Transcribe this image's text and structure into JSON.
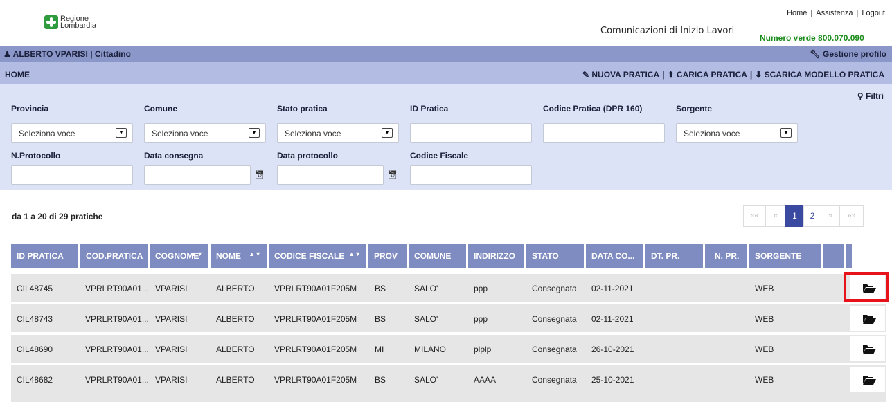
{
  "header": {
    "logo_line1": "Regione",
    "logo_line2": "Lombardia",
    "links": [
      "Home",
      "Assistenza",
      "Logout"
    ],
    "app_title": "Comunicazioni di Inizio Lavori",
    "phone": "Numero verde 800.070.090"
  },
  "userbar": {
    "user": "ALBERTO VPARISI | Cittadino",
    "profile": "Gestione profilo"
  },
  "navbar": {
    "home": "HOME",
    "actions": [
      "NUOVA PRATICA",
      "CARICA PRATICA",
      "SCARICA MODELLO PRATICA"
    ]
  },
  "filters": {
    "toggle": "Filtri",
    "provincia": {
      "label": "Provincia",
      "value": "Seleziona voce"
    },
    "comune": {
      "label": "Comune",
      "value": "Seleziona voce"
    },
    "stato": {
      "label": "Stato pratica",
      "value": "Seleziona voce"
    },
    "id_pratica": {
      "label": "ID Pratica",
      "value": ""
    },
    "codice_pratica": {
      "label": "Codice Pratica (DPR 160)",
      "value": ""
    },
    "sorgente": {
      "label": "Sorgente",
      "value": "Seleziona voce"
    },
    "protocollo": {
      "label": "N.Protocollo",
      "value": ""
    },
    "data_consegna": {
      "label": "Data consegna",
      "value": ""
    },
    "data_protocollo": {
      "label": "Data protocollo",
      "value": ""
    },
    "codice_fiscale": {
      "label": "Codice Fiscale",
      "value": ""
    }
  },
  "results": {
    "count": "da 1 a 20 di 29 pratiche"
  },
  "pagination": {
    "first": "««",
    "prev": "«",
    "pages": [
      "1",
      "2"
    ],
    "current": "1",
    "next": "»",
    "last": "»»"
  },
  "table": {
    "columns": [
      "ID PRATICA",
      "COD.PRATICA",
      "COGNOME",
      "NOME",
      "CODICE FISCALE",
      "PROV",
      "COMUNE",
      "INDIRIZZO",
      "STATO",
      "DATA CO...",
      "DT. PR.",
      "N. PR.",
      "SORGENTE",
      "",
      ""
    ],
    "rows": [
      {
        "id": "CIL48745",
        "cod": "VPRLRT90A01...",
        "cognome": "VPARISI",
        "nome": "ALBERTO",
        "cf": "VPRLRT90A01F205M",
        "prov": "BS",
        "comune": "SALO'",
        "indirizzo": "ppp",
        "stato": "Consegnata",
        "data": "02-11-2021",
        "dtpr": "",
        "npr": "",
        "sorgente": "WEB"
      },
      {
        "id": "CIL48743",
        "cod": "VPRLRT90A01...",
        "cognome": "VPARISI",
        "nome": "ALBERTO",
        "cf": "VPRLRT90A01F205M",
        "prov": "BS",
        "comune": "SALO'",
        "indirizzo": "ppp",
        "stato": "Consegnata",
        "data": "02-11-2021",
        "dtpr": "",
        "npr": "",
        "sorgente": "WEB"
      },
      {
        "id": "CIL48690",
        "cod": "VPRLRT90A01...",
        "cognome": "VPARISI",
        "nome": "ALBERTO",
        "cf": "VPRLRT90A01F205M",
        "prov": "MI",
        "comune": "MILANO",
        "indirizzo": "plplp",
        "stato": "Consegnata",
        "data": "26-10-2021",
        "dtpr": "",
        "npr": "",
        "sorgente": "WEB"
      },
      {
        "id": "CIL48682",
        "cod": "VPRLRT90A01...",
        "cognome": "VPARISI",
        "nome": "ALBERTO",
        "cf": "VPRLRT90A01F205M",
        "prov": "BS",
        "comune": "SALO'",
        "indirizzo": "AAAA",
        "stato": "Consegnata",
        "data": "25-10-2021",
        "dtpr": "",
        "npr": "",
        "sorgente": "WEB"
      }
    ]
  },
  "colors": {
    "userbar": "#8b97c9",
    "navbar": "#b3bde4",
    "filters": "#dde3f6",
    "table_header": "#7f8cc2",
    "highlight": "#e8121b",
    "phone": "#1a8c1a"
  },
  "icons": [
    "user-icon",
    "wrench-icon",
    "pencil-icon",
    "upload-icon",
    "download-icon",
    "zoom-icon",
    "calendar-icon",
    "folder-open-icon"
  ]
}
